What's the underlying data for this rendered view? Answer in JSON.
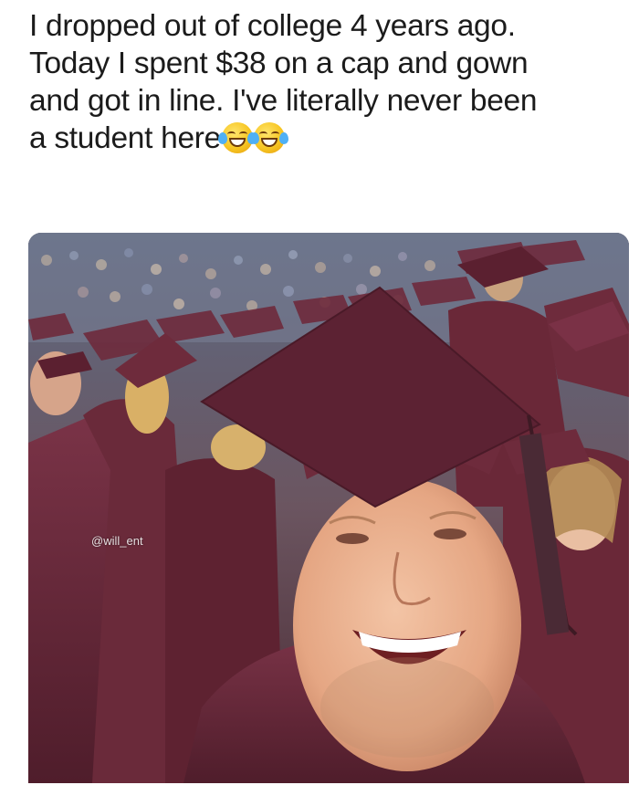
{
  "caption": {
    "lines": [
      "I dropped out of college 4 years ago.",
      "Today I spent $38 on a cap and gown",
      "and got in line. I've literally never been",
      "a student here"
    ],
    "emojis": [
      "face-with-tears-of-joy",
      "face-with-tears-of-joy"
    ]
  },
  "photo": {
    "description_icon": "graduation-selfie-photo",
    "watermark": "@will_ent",
    "colors": {
      "gown": "#6e2b3c",
      "crowd": "#4a4a5a",
      "skin": "#e9b08e"
    }
  }
}
